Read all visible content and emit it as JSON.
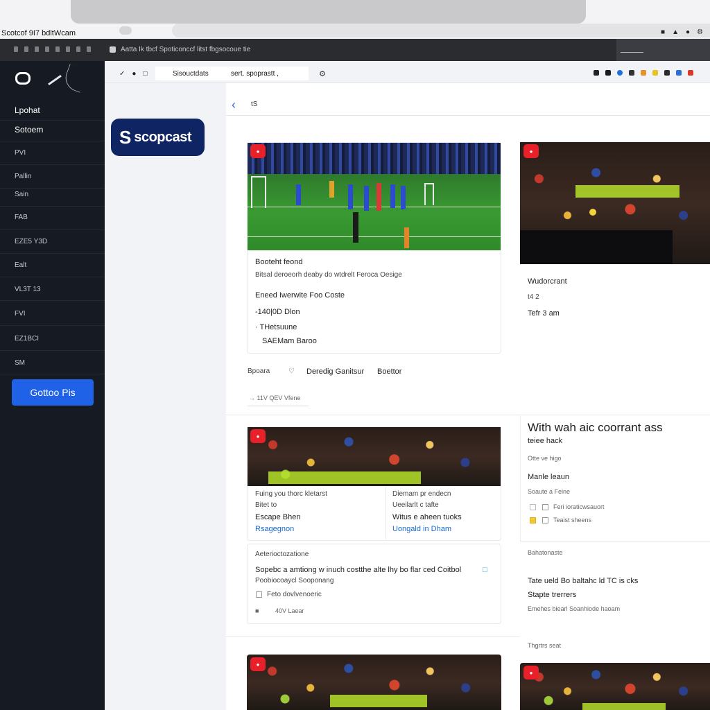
{
  "os": {
    "title": "Scotcof 9I7 bdltWcam",
    "icons": [
      "lock-icon",
      "folder-icon",
      "circle-icon",
      "gear-icon"
    ]
  },
  "toolbar": {
    "url_text": "Aatta Ik tbcf Spoticonccf litst fbgsocoue tie"
  },
  "sidebar": {
    "items": [
      {
        "label": "Lpohat"
      },
      {
        "label": "Sotoem"
      },
      {
        "label": "PVI"
      },
      {
        "label": "Pallin"
      },
      {
        "label": "Sain"
      },
      {
        "label": "FAB"
      },
      {
        "label": "EZE5 Y3D"
      },
      {
        "label": "Ealt"
      },
      {
        "label": "VL3T 13"
      },
      {
        "label": "FVI"
      },
      {
        "label": "EZ1BCI"
      },
      {
        "label": "SM"
      }
    ],
    "cta_label": "Gottoo Pis"
  },
  "address_bar": {
    "url": "Sisouctdats",
    "search_text": "sert. spoprastt ,"
  },
  "brand": {
    "mark": "S",
    "name": "scopcast"
  },
  "header": {
    "crumb": "tS"
  },
  "featured_card": {
    "badge": "●",
    "title": "Booteht feond",
    "subtitle": "Bitsal deroeorh deaby do wtdrelt Feroca Oesige",
    "line1": "Eneed Iwerwite Foo Coste",
    "line2": "-140|0D  Dlon",
    "line3": "· THetsuune",
    "line4": "SAEMam Baroo",
    "footer_left": "Bpoara",
    "footer_mid": "Deredig Ganitsur",
    "footer_right": "Boettor",
    "footer_link": "→ 11V QEV Vfene"
  },
  "side_card": {
    "badge": "●",
    "title": "Wudorcrant",
    "meta1": "t4   2",
    "meta2": "Tefr 3 am"
  },
  "second_card": {
    "badge": "●",
    "col1": [
      "Fuing you thorc kletarst",
      "Bitet to",
      "Escape Bhen",
      "Rsagegnon"
    ],
    "col2": [
      "Diemam pr endecn",
      "Ueeilarlt c tafte",
      "Witus e aheen tuoks",
      "Uongald in Dham"
    ],
    "section_title": "Aeterioctozatione",
    "desc1": "Sopebc a amtiong w inuch costthe alte lhy bo flar ced Coitbol",
    "desc2": "Poobiocoaycl Sooponang",
    "check1": "Feto dovlvenoeric",
    "check2": "40V Laear"
  },
  "right_panel": {
    "heading": "With wah aic coorrant ass",
    "subheading": "teiee hack",
    "meta": "Otte ve higo",
    "label": "Manle leaun",
    "sub_label": "Soaute a Feine",
    "check1": "Feri ioraticwsauort",
    "check2": "Teaist sheens",
    "section": "Bahatonaste",
    "line1": "Tate ueld Bo baltahc ld TC is cks",
    "line2": "Stapte trerrers",
    "line3": "Emehes biearl Soanhiode haoam",
    "footer": "Thgrtrs seat"
  },
  "bottom_cards": [
    {
      "badge": "●"
    },
    {
      "badge": "●"
    }
  ]
}
